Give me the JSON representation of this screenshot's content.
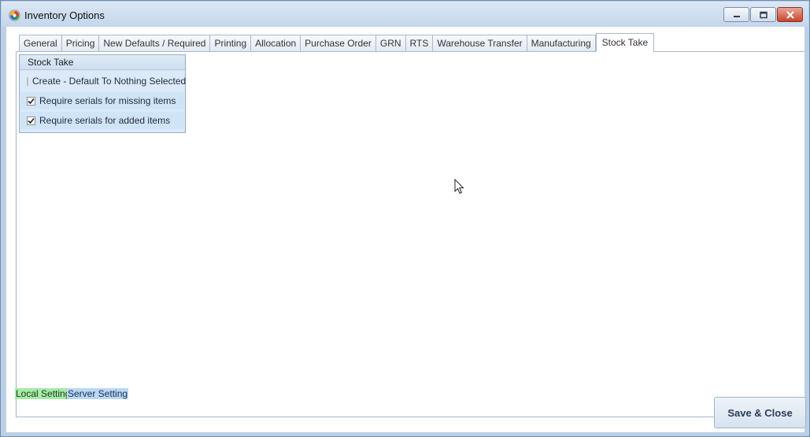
{
  "window": {
    "title": "Inventory Options",
    "icon": "app-logo-icon",
    "controls": [
      "minimize-icon",
      "maximize-icon",
      "close-icon"
    ]
  },
  "tabs": [
    {
      "label": "General",
      "active": false
    },
    {
      "label": "Pricing",
      "active": false
    },
    {
      "label": "New Defaults / Required",
      "active": false
    },
    {
      "label": "Printing",
      "active": false
    },
    {
      "label": "Allocation",
      "active": false
    },
    {
      "label": "Purchase Order",
      "active": false
    },
    {
      "label": "GRN",
      "active": false
    },
    {
      "label": "RTS",
      "active": false
    },
    {
      "label": "Warehouse Transfer",
      "active": false
    },
    {
      "label": "Manufacturing",
      "active": false
    },
    {
      "label": "Stock Take",
      "active": true
    }
  ],
  "stock_take": {
    "group_title": "Stock Take",
    "options": [
      {
        "label": "Create - Default To Nothing Selected",
        "checked": false,
        "enabled": false
      },
      {
        "label": "Require serials for missing items",
        "checked": true,
        "enabled": true
      },
      {
        "label": "Require serials for added items",
        "checked": true,
        "enabled": true
      }
    ]
  },
  "legend": {
    "local": "Local Setting",
    "server": "Server Setting",
    "local_color": "#a6eaa6",
    "server_color": "#b9d8f6"
  },
  "footer": {
    "save_label": "Save & Close"
  }
}
